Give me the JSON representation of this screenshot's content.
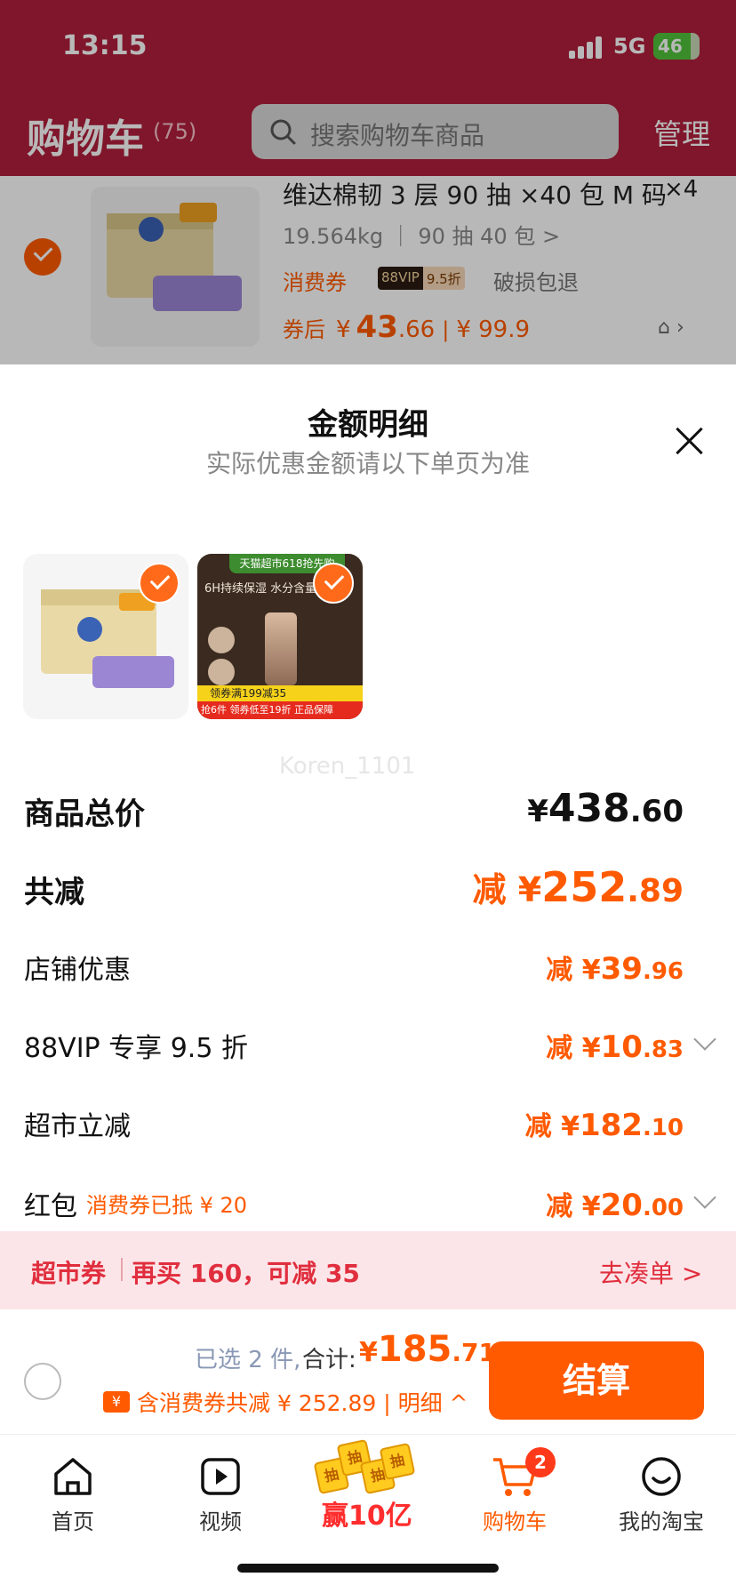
{
  "status_bar": {
    "time": "13:15",
    "network": "5G",
    "battery": "46"
  },
  "header": {
    "title": "购物车",
    "count": "(75)",
    "search_placeholder": "搜索购物车商品",
    "manage_label": "管理"
  },
  "cart_item": {
    "name": "维达棉韧 3 层 90 抽 ×40 包 M 码",
    "qty": "×4",
    "spec": "19.564kg ｜ 90 抽 40 包 >",
    "tag_coupon": "消费券",
    "vip_badge": "88VIP",
    "vip_discount": "9.5折",
    "tag_return": "破损包退",
    "price_label": "券后",
    "price_yen": "¥",
    "price_big": "43",
    "price_small": ".66",
    "original_price": "¥ 99.9"
  },
  "sheet": {
    "title": "金额明细",
    "subtitle": "实际优惠金额请以下单页为准",
    "thumb2_banner": "天猫超市618抢先购",
    "thumb2_text": "6H持续保湿 水分含量",
    "thumb2_coupon": "领券满199减35",
    "thumb2_strip": "抢6件 领券低至19折 正品保障",
    "watermark": "Koren_1101",
    "rows": {
      "total": {
        "label": "商品总价",
        "yen": "¥",
        "big": "438",
        "small": ".60"
      },
      "minus": {
        "label": "共减",
        "prefix": "减 ¥",
        "big": "252",
        "small": ".89"
      },
      "shop": {
        "label": "店铺优惠",
        "prefix": "减 ¥",
        "big": "39",
        "small": ".96"
      },
      "vip": {
        "label": "88VIP 专享 9.5 折",
        "prefix": "减 ¥",
        "big": "10",
        "small": ".83"
      },
      "market": {
        "label": "超市立减",
        "prefix": "减 ¥",
        "big": "182",
        "small": ".10"
      },
      "red": {
        "label": "红包",
        "note": "消费券已抵 ¥ 20",
        "prefix": "减 ¥",
        "big": "20",
        "small": ".00"
      }
    }
  },
  "coupon_bar": {
    "label": "超市券",
    "message": "再买 160，可减 35",
    "action": "去凑单 >"
  },
  "checkout": {
    "selected": "已选 2 件,",
    "sum_label": "合计:",
    "sum_yen": "¥",
    "sum_big": "185",
    "sum_small": ".71",
    "coupon_icon": "¥",
    "saving_text": "含消费券共减 ¥ 252.89 | 明细 ^",
    "pay_label": "结算"
  },
  "tabbar": {
    "home": "首页",
    "video": "视频",
    "promo_word": "赢10亿",
    "promo_tiles": [
      "抽",
      "抽",
      "抽",
      "抽"
    ],
    "cart": "购物车",
    "cart_badge": "2",
    "me": "我的淘宝"
  },
  "colors": {
    "accent": "#ff5a00",
    "header": "#b21f3c",
    "coupon_bg": "#fce5e8"
  }
}
